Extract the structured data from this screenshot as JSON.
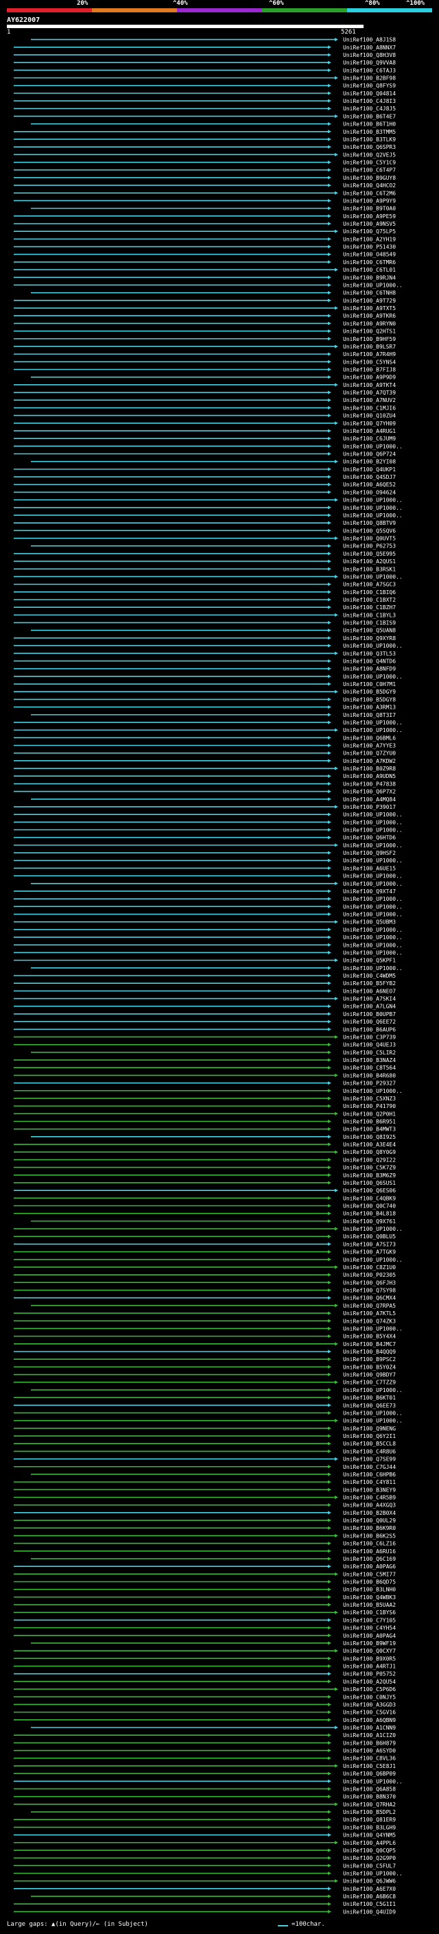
{
  "header": {
    "scale_labels": [
      "20%",
      "^40%",
      "^60%",
      "^80%",
      "^100%"
    ],
    "scale_colors": [
      "#e0202a",
      "#e07a20",
      "#9a2ad0",
      "#2aa02a",
      "#2ad0e0"
    ],
    "query_name": "AY622007",
    "pos_start": "1",
    "pos_end": "5261"
  },
  "colors": {
    "cyan": "#4ad0e0",
    "green": "#3ab83a",
    "background": "#000000"
  },
  "legend": {
    "left_text": "Large gaps: ▲(in Query)/← (in Subject)",
    "right_text": "=100char."
  },
  "hits": [
    "UniRef100_A8J1S8",
    "UniRef100_A8NNX7",
    "UniRef100_Q8H3V8",
    "UniRef100_Q9VVA8",
    "UniRef100_C6TAJ3",
    "UniRef100_B2BF98",
    "UniRef100_Q8FYS9",
    "UniRef100_Q04814",
    "UniRef100_C4J8I3",
    "UniRef100_C4J8J5",
    "UniRef100_B6T4E7",
    "UniRef100_B6T1H0",
    "UniRef100_B3TMM5",
    "UniRef100_B3TLK9",
    "UniRef100_Q6SPR3",
    "UniRef100_Q2VEJ5",
    "UniRef100_C5Y1C9",
    "UniRef100_C6T4P7",
    "UniRef100_B9GUY8",
    "UniRef100_Q4HCO2",
    "UniRef100_C6T2M6",
    "UniRef100_A9P9Y9",
    "UniRef100_B9T0A0",
    "UniRef100_A9PE59",
    "UniRef100_A9NSV5",
    "UniRef100_Q75LP5",
    "UniRef100_A2YH19",
    "UniRef100_P51430",
    "UniRef100_O48549",
    "UniRef100_C6TMR6",
    "UniRef100_C6TL01",
    "UniRef100_B9RJN4",
    "UniRef100_UP1000..",
    "UniRef100_C6TNH8",
    "UniRef100_A9T729",
    "UniRef100_A9TXT5",
    "UniRef100_A9TKR6",
    "UniRef100_A9RYN0",
    "UniRef100_Q2HTS1",
    "UniRef100_B9HF59",
    "UniRef100_B9LSR7",
    "UniRef100_A7R4H9",
    "UniRef100_C5YNS4",
    "UniRef100_B7FIJ8",
    "UniRef100_A9P9D9",
    "UniRef100_A9TKT4",
    "UniRef100_A7QT39",
    "UniRef100_A7NUV2",
    "UniRef100_C1MJI6",
    "UniRef100_Q10ZU4",
    "UniRef100_Q7YH09",
    "UniRef100_A4RUG1",
    "UniRef100_C6JUM9",
    "UniRef100_UP1000..",
    "UniRef100_Q6P724",
    "UniRef100_B2YI08",
    "UniRef100_Q4UKP1",
    "UniRef100_Q4SDJ7",
    "UniRef100_A6QE52",
    "UniRef100_O94624",
    "UniRef100_UP1000..",
    "UniRef100_UP1000..",
    "UniRef100_UP1000..",
    "UniRef100_Q8BTV9",
    "UniRef100_Q5SQV6",
    "UniRef100_Q0UVT5",
    "UniRef100_P62753",
    "UniRef100_Q5E995",
    "UniRef100_A2QUS1",
    "UniRef100_B3RSK1",
    "UniRef100_UP1000..",
    "UniRef100_A7SGC3",
    "UniRef100_C1BIQ6",
    "UniRef100_C1BXT2",
    "UniRef100_C1BZH7",
    "UniRef100_C1BYL3",
    "UniRef100_C1BIS9",
    "UniRef100_Q5UAN8",
    "UniRef100_Q9XYR8",
    "UniRef100_UP1000..",
    "UniRef100_Q3TL53",
    "UniRef100_Q4NTD6",
    "UniRef100_A8NFD9",
    "UniRef100_UP1000..",
    "UniRef100_C0H7M1",
    "UniRef100_B5DGY9",
    "UniRef100_B5DGY8",
    "UniRef100_A3RM13",
    "UniRef100_Q8T3I7",
    "UniRef100_UP1000..",
    "UniRef100_UP1000..",
    "UniRef100_Q6BML6",
    "UniRef100_A7YYE3",
    "UniRef100_Q7ZYU0",
    "UniRef100_A7KDW2",
    "UniRef100_B0Z9R8",
    "UniRef100_A9UDN5",
    "UniRef100_P47838",
    "UniRef100_Q6P7X2",
    "UniRef100_A4MQ84",
    "UniRef100_P39017",
    "UniRef100_UP1000..",
    "UniRef100_UP1000..",
    "UniRef100_UP1000..",
    "UniRef100_Q6HTD6",
    "UniRef100_UP1000..",
    "UniRef100_Q9HSF2",
    "UniRef100_UP1000..",
    "UniRef100_A6UE15",
    "UniRef100_UP1000..",
    "UniRef100_UP1000..",
    "UniRef100_Q9XT47",
    "UniRef100_UP1000..",
    "UniRef100_UP1000..",
    "UniRef100_UP1000..",
    "UniRef100_Q5UBM3",
    "UniRef100_UP1000..",
    "UniRef100_UP1000..",
    "UniRef100_UP1000..",
    "UniRef100_UP1000..",
    "UniRef100_Q5KPF1",
    "UniRef100_UP1000..",
    "UniRef100_C4WDM5",
    "UniRef100_B5FYB2",
    "UniRef100_A6NEO7",
    "UniRef100_A7SKI4",
    "UniRef100_A7LGN4",
    "UniRef100_B0UPB7",
    "UniRef100_Q6EE72",
    "UniRef100_B6AUP6",
    "UniRef100_C3P739",
    "UniRef100_Q4UEJ3",
    "UniRef100_C5LIR2",
    "UniRef100_B3NAZ4",
    "UniRef100_C8T564",
    "UniRef100_B4R680",
    "UniRef100_P29327",
    "UniRef100_UP1000..",
    "UniRef100_C5XNZ3",
    "UniRef100_P41790",
    "UniRef100_Q2P0H1",
    "UniRef100_B6R951",
    "UniRef100_B4MWT3",
    "UniRef100_Q8I925",
    "UniRef100_A3E4E4",
    "UniRef100_Q8Y0G9",
    "UniRef100_Q29I22",
    "UniRef100_C5K7Z9",
    "UniRef100_B3M6Z9",
    "UniRef100_Q6SUS1",
    "UniRef100_Q6ES06",
    "UniRef100_C4QBK9",
    "UniRef100_Q0C740",
    "UniRef100_B4L818",
    "UniRef100_Q9X761",
    "UniRef100_UP1000..",
    "UniRef100_Q0BLU5",
    "UniRef100_A7SI73",
    "UniRef100_A7TGK9",
    "UniRef100_UP1000..",
    "UniRef100_C8Z1U0",
    "UniRef100_P02305",
    "UniRef100_Q6FJH3",
    "UniRef100_Q7SY98",
    "UniRef100_Q6CMX4",
    "UniRef100_Q7RPA5",
    "UniRef100_A7KTL5",
    "UniRef100_Q74ZK3",
    "UniRef100_UP1000..",
    "UniRef100_B5Y4X4",
    "UniRef100_B4JMC7",
    "UniRef100_B4QQQ9",
    "UniRef100_B9PSC2",
    "UniRef100_B5Y0Z4",
    "UniRef100_Q9BDY7",
    "UniRef100_C7TZZ9",
    "UniRef100_UP1000..",
    "UniRef100_B6KT01",
    "UniRef100_Q6EE73",
    "UniRef100_UP1000..",
    "UniRef100_UP1000..",
    "UniRef100_Q9NENG",
    "UniRef100_Q6Y2I1",
    "UniRef100_B5CCL8",
    "UniRef100_C4R8U6",
    "UniRef100_Q7SE99",
    "UniRef100_C7GJ44",
    "UniRef100_C6HPB6",
    "UniRef100_C4Y811",
    "UniRef100_B3NEY9",
    "UniRef100_C4R5B9",
    "UniRef100_A4XGQ3",
    "UniRef100_B2B0X4",
    "UniRef100_Q0UL29",
    "UniRef100_B6K9R0",
    "UniRef100_B6K2S5",
    "UniRef100_C6LZ16",
    "UniRef100_A6RU16",
    "UniRef100_Q6C169",
    "UniRef100_A0PAG6",
    "UniRef100_C5MI77",
    "UniRef100_B6QD75",
    "UniRef100_B3LNH0",
    "UniRef100_Q4WBK3",
    "UniRef100_B5UAA2",
    "UniRef100_C1BYS6",
    "UniRef100_C7Y105",
    "UniRef100_C4YH54",
    "UniRef100_A0PAG4",
    "UniRef100_B9WF19",
    "UniRef100_Q0CXY7",
    "UniRef100_B9X0R5",
    "UniRef100_A4RTJ1",
    "UniRef100_P05752",
    "UniRef100_A2QU54",
    "UniRef100_C5P6D6",
    "UniRef100_C0NJY5",
    "UniRef100_A3GGD3",
    "UniRef100_C5GV16",
    "UniRef100_A6QBN9",
    "UniRef100_A1CNN9",
    "UniRef100_A1CIZ0",
    "UniRef100_B6H879",
    "UniRef100_A6SYD0",
    "UniRef100_C8VL36",
    "UniRef100_C5E8J1",
    "UniRef100_Q6BP09",
    "UniRef100_UP1000..",
    "UniRef100_Q6A858",
    "UniRef100_B8N370",
    "UniRef100_Q7RHA2",
    "UniRef100_B5DPL2",
    "UniRef100_Q81ER9",
    "UniRef100_B3LGH9",
    "UniRef100_Q4YNM5",
    "UniRef100_A4PPL6",
    "UniRef100_Q0CQP5",
    "UniRef100_Q2G9P0",
    "UniRef100_C5FUL7",
    "UniRef100_UP1000..",
    "UniRef100_Q6JWW6",
    "UniRef100_A6E7X0",
    "UniRef100_A6B6C8",
    "UniRef100_C5G1I1",
    "UniRef100_Q4UID9"
  ]
}
